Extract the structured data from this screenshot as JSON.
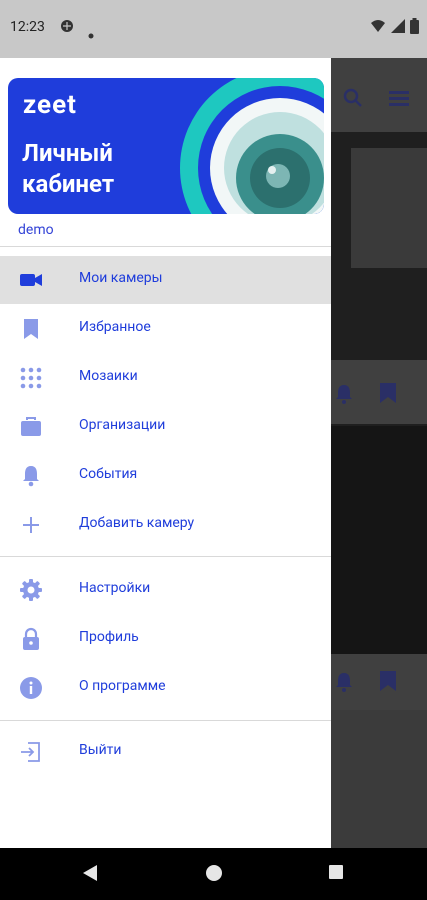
{
  "status_bar": {
    "time": "12:23"
  },
  "drawer": {
    "banner": {
      "logo": "zeet",
      "title_line1": "Личный",
      "title_line2": "кабинет"
    },
    "account": "demo",
    "menu": [
      {
        "label": "Мои камеры",
        "icon": "videocam-icon",
        "active": true
      },
      {
        "label": "Избранное",
        "icon": "bookmark-icon"
      },
      {
        "label": "Мозаики",
        "icon": "grid-icon"
      },
      {
        "label": "Организации",
        "icon": "briefcase-icon"
      },
      {
        "label": "События",
        "icon": "bell-icon"
      },
      {
        "label": "Добавить камеру",
        "icon": "plus-icon"
      },
      {
        "label": "Настройки",
        "icon": "gear-icon"
      },
      {
        "label": "Профиль",
        "icon": "lock-icon"
      },
      {
        "label": "О программе",
        "icon": "info-icon"
      },
      {
        "label": "Выйти",
        "icon": "logout-icon"
      }
    ]
  },
  "colors": {
    "accent": "#1f3ddb",
    "icon": "#8a9ae8",
    "active_bg": "#e0e0e0",
    "banner_teal": "#1ec8c0"
  }
}
